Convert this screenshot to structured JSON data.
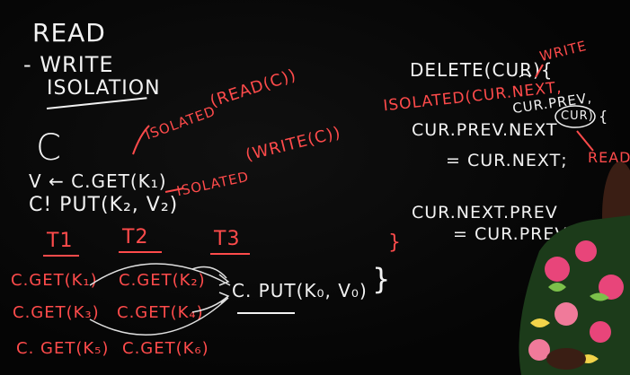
{
  "board": {
    "left": {
      "read": "READ",
      "write": "- WRITE",
      "isolation": "ISOLATION",
      "c_var": "C",
      "isolated_read": "ISOLATED",
      "read_c": "(READ(C))",
      "isolated_write": "ISOLATED",
      "write_c": "(WRITE(C))",
      "v_line": "V ← C.GET(K₁)",
      "put_line": "C! PUT(K₂, V₂)",
      "t1": "T1",
      "t2": "T2",
      "t3": "T3",
      "t1_a": "C.GET(K₁)",
      "t1_b": "C.GET(K₃)",
      "t1_c": "C. GET(K₅)",
      "t2_a": "C.GET(K₂)",
      "t2_b": "C.GET(K₄)",
      "t2_c": "C.GET(K₆)",
      "t3_a": "C. PUT(K₀, V₀)"
    },
    "right": {
      "delete": "DELETE(CUR){",
      "write": "WRITE",
      "isolated": "ISOLATED(CUR.NEXT,",
      "cur_prev": "CUR.PREV,",
      "cur": "CUR)",
      "brace": "{",
      "read": "READ",
      "cur_prev_next": "CUR.PREV.NEXT",
      "eq_cur_next": "= CUR.NEXT;",
      "cur_next_prev": "CUR.NEXT.PREV",
      "eq_cur_prev": "= CUR.PREV",
      "close1": "}",
      "close2": "}"
    }
  },
  "colors": {
    "background": "#050505",
    "chalk_white": "#f2f2f2",
    "chalk_red": "#ff4b4b",
    "shirt_pink": "#e8457a",
    "shirt_green": "#3f8a3a"
  }
}
